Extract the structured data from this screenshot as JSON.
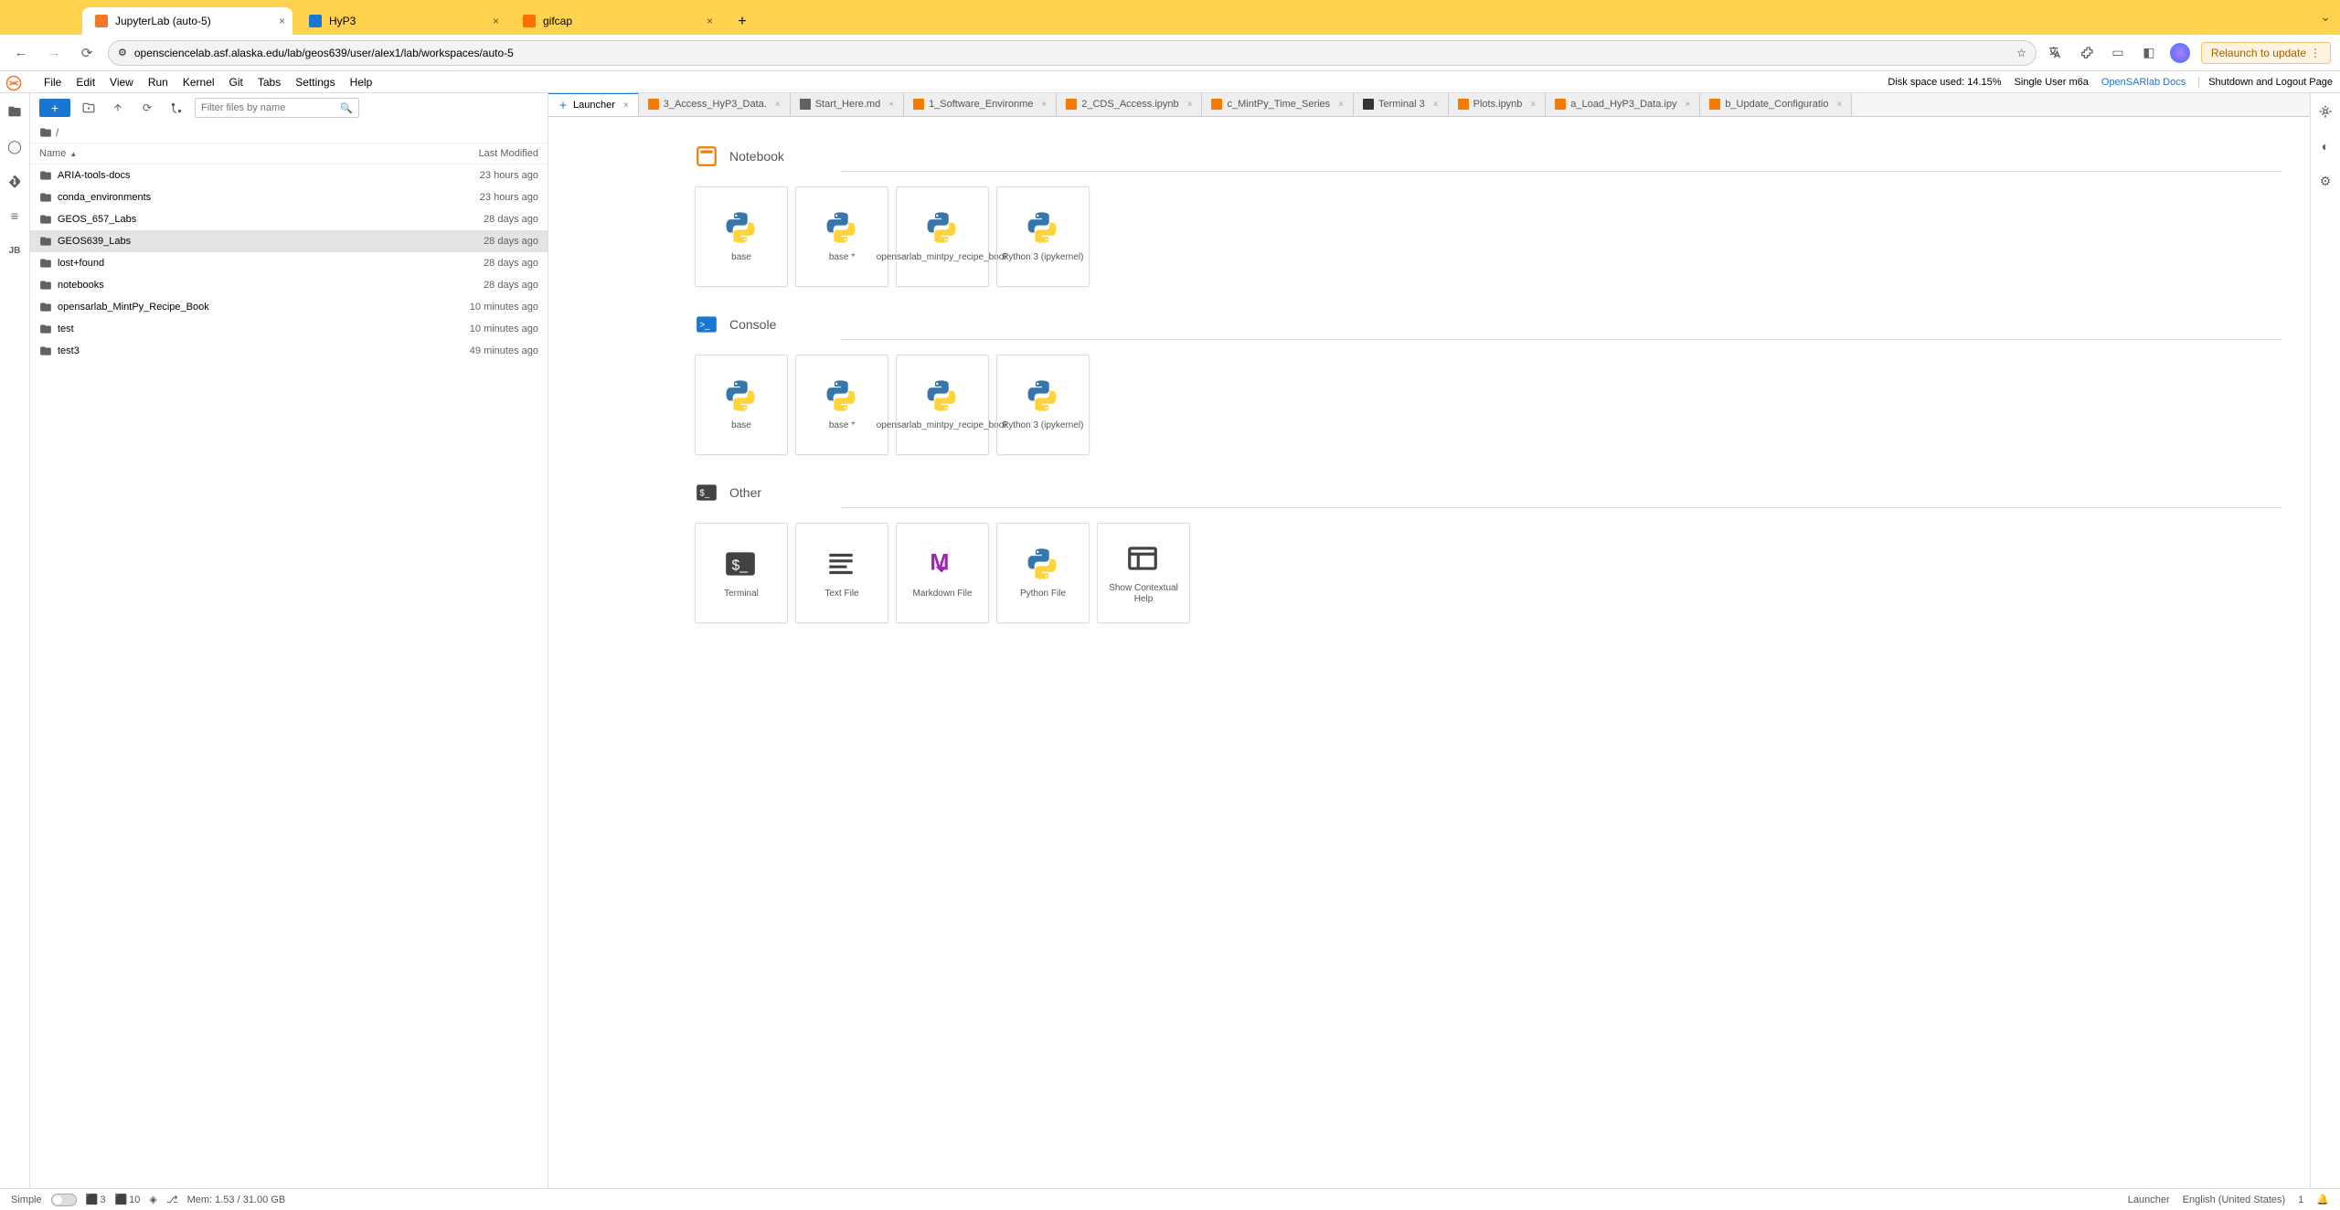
{
  "browser": {
    "tabs": [
      {
        "label": "JupyterLab (auto-5)",
        "favicon": "#f37726",
        "active": true
      },
      {
        "label": "HyP3",
        "favicon": "#1976d2",
        "active": false
      },
      {
        "label": "gifcap",
        "favicon": "#ff6f00",
        "active": false
      }
    ],
    "url": "opensciencelab.asf.alaska.edu/lab/geos639/user/alex1/lab/workspaces/auto-5",
    "relaunch": "Relaunch to update"
  },
  "menu": [
    "File",
    "Edit",
    "View",
    "Run",
    "Kernel",
    "Git",
    "Tabs",
    "Settings",
    "Help"
  ],
  "topright": {
    "disk": "Disk space used: 14.15%",
    "user": "Single User m6a",
    "docs": "OpenSARlab Docs",
    "shutdown": "Shutdown and Logout Page"
  },
  "filebrowser": {
    "filter_placeholder": "Filter files by name",
    "breadcrumb": "/",
    "columns": {
      "name": "Name",
      "modified": "Last Modified"
    },
    "rows": [
      {
        "name": "ARIA-tools-docs",
        "modified": "23 hours ago"
      },
      {
        "name": "conda_environments",
        "modified": "23 hours ago"
      },
      {
        "name": "GEOS_657_Labs",
        "modified": "28 days ago"
      },
      {
        "name": "GEOS639_Labs",
        "modified": "28 days ago",
        "selected": true
      },
      {
        "name": "lost+found",
        "modified": "28 days ago"
      },
      {
        "name": "notebooks",
        "modified": "28 days ago"
      },
      {
        "name": "opensarlab_MintPy_Recipe_Book",
        "modified": "10 minutes ago"
      },
      {
        "name": "test",
        "modified": "10 minutes ago"
      },
      {
        "name": "test3",
        "modified": "49 minutes ago"
      }
    ]
  },
  "doctabs": [
    {
      "label": "Launcher",
      "icon": "plus",
      "active": true
    },
    {
      "label": "3_Access_HyP3_Data.",
      "icon": "nb"
    },
    {
      "label": "Start_Here.md",
      "icon": "md"
    },
    {
      "label": "1_Software_Environme",
      "icon": "nb"
    },
    {
      "label": "2_CDS_Access.ipynb",
      "icon": "nb"
    },
    {
      "label": "c_MintPy_Time_Series",
      "icon": "nb"
    },
    {
      "label": "Terminal 3",
      "icon": "term"
    },
    {
      "label": "Plots.ipynb",
      "icon": "nb"
    },
    {
      "label": "a_Load_HyP3_Data.ipy",
      "icon": "nb"
    },
    {
      "label": "b_Update_Configuratio",
      "icon": "nb"
    }
  ],
  "launcher": {
    "sections": [
      {
        "title": "Notebook",
        "icon": "notebook",
        "cards": [
          {
            "label": "base",
            "icon": "python"
          },
          {
            "label": "base *",
            "icon": "python"
          },
          {
            "label": "opensarlab_mintpy_recipe_book",
            "icon": "python"
          },
          {
            "label": "Python 3 (ipykernel)",
            "icon": "python"
          }
        ]
      },
      {
        "title": "Console",
        "icon": "console",
        "cards": [
          {
            "label": "base",
            "icon": "python"
          },
          {
            "label": "base *",
            "icon": "python"
          },
          {
            "label": "opensarlab_mintpy_recipe_book",
            "icon": "python"
          },
          {
            "label": "Python 3 (ipykernel)",
            "icon": "python"
          }
        ]
      },
      {
        "title": "Other",
        "icon": "other",
        "cards": [
          {
            "label": "Terminal",
            "icon": "terminal"
          },
          {
            "label": "Text File",
            "icon": "text"
          },
          {
            "label": "Markdown File",
            "icon": "markdown"
          },
          {
            "label": "Python File",
            "icon": "python"
          },
          {
            "label": "Show Contextual Help",
            "icon": "help"
          }
        ]
      }
    ]
  },
  "statusbar": {
    "simple": "Simple",
    "terminals": "3",
    "kernels": "10",
    "mem": "Mem: 1.53 / 31.00 GB",
    "mode": "Launcher",
    "lang": "English (United States)",
    "ln": "1"
  }
}
